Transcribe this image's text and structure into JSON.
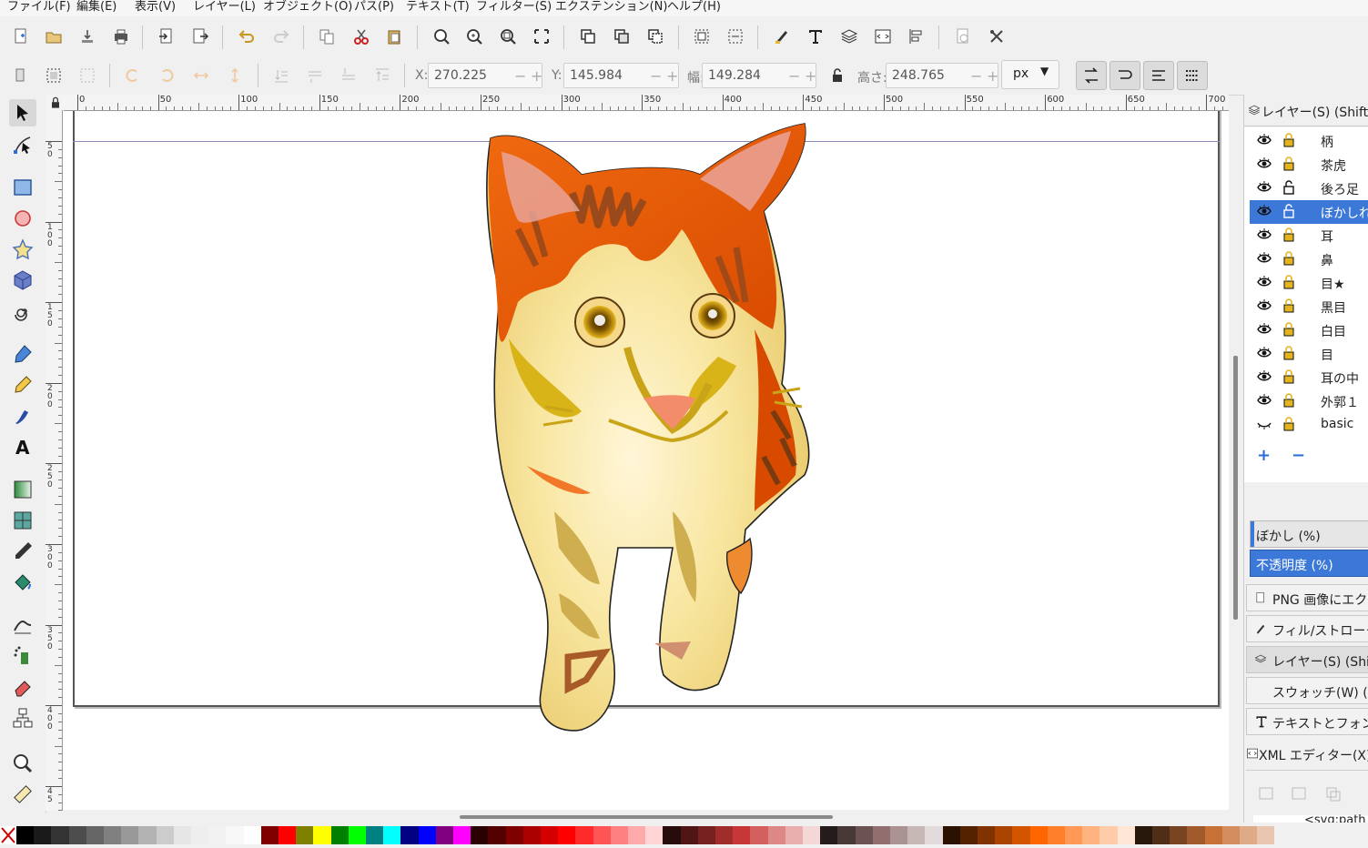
{
  "menu": [
    "ファイル(F)",
    "編集(E)",
    "表示(V)",
    "レイヤー(L)",
    "オブジェクト(O)",
    "パス(P)",
    "テキスト(T)",
    "フィルター(S)",
    "エクステンション(N)",
    "ヘルプ(H)"
  ],
  "controls": {
    "x_label": "X:",
    "x_value": "270.225",
    "y_label": "Y:",
    "y_value": "145.984",
    "w_label": "幅:",
    "w_value": "149.284",
    "h_label": "高さ:",
    "h_value": "248.765",
    "unit": "px"
  },
  "ruler": {
    "h_ticks": [
      "0",
      "50",
      "100",
      "150",
      "200",
      "250",
      "300",
      "350",
      "400",
      "450",
      "500",
      "550",
      "600",
      "650",
      "700"
    ],
    "v_ticks": [
      "5\n0",
      "1\n0\n0",
      "1\n5\n0",
      "2\n0\n0",
      "2\n5\n0",
      "3\n0\n0",
      "3\n5\n0",
      "4\n0\n0",
      "4\n5"
    ]
  },
  "layers_panel": {
    "title": "レイヤー(S) (Shift+C",
    "layers": [
      {
        "name": "柄",
        "visible": true,
        "locked": true
      },
      {
        "name": "茶虎",
        "visible": true,
        "locked": true
      },
      {
        "name": "後ろ足",
        "visible": true,
        "locked": false
      },
      {
        "name": "ぼかしれ",
        "visible": true,
        "locked": false,
        "selected": true
      },
      {
        "name": "耳",
        "visible": true,
        "locked": true
      },
      {
        "name": "鼻",
        "visible": true,
        "locked": true
      },
      {
        "name": "目★",
        "visible": true,
        "locked": true
      },
      {
        "name": "黒目",
        "visible": true,
        "locked": true
      },
      {
        "name": "白目",
        "visible": true,
        "locked": true
      },
      {
        "name": "目",
        "visible": true,
        "locked": true
      },
      {
        "name": "耳の中",
        "visible": true,
        "locked": true
      },
      {
        "name": "外郭１",
        "visible": true,
        "locked": true
      },
      {
        "name": "basic",
        "visible": false,
        "locked": true
      }
    ],
    "add_label": "+",
    "remove_label": "−",
    "blur_label": "ぼかし (%)",
    "opacity_label": "不透明度 (%)"
  },
  "docks": [
    {
      "label": "PNG 画像にエクス"
    },
    {
      "label": "フィル/ストローク(F)"
    },
    {
      "label": "レイヤー(S) (Shift+"
    },
    {
      "label": "スウォッチ(W) (Shi"
    },
    {
      "label": "テキストとフォント(T"
    },
    {
      "label": "XML エディター(X) (S"
    }
  ],
  "xml_node": "<svg:path i",
  "palette": [
    "#000000",
    "#1a1a1a",
    "#333333",
    "#4d4d4d",
    "#666666",
    "#808080",
    "#999999",
    "#b3b3b3",
    "#cccccc",
    "#e6e6e6",
    "#eeeeee",
    "#f2f2f2",
    "#f8f8f8",
    "#ffffff",
    "#800000",
    "#ff0000",
    "#808000",
    "#ffff00",
    "#008000",
    "#00ff00",
    "#008080",
    "#00ffff",
    "#000080",
    "#0000ff",
    "#800080",
    "#ff00ff",
    "#2b0000",
    "#550000",
    "#800000",
    "#aa0000",
    "#d40000",
    "#ff0000",
    "#ff2a2a",
    "#ff5555",
    "#ff8080",
    "#ffaaaa",
    "#ffd5d5",
    "#280b0b",
    "#501616",
    "#782121",
    "#a02c2c",
    "#c83737",
    "#d35f5f",
    "#de8787",
    "#e9afaf",
    "#f4d7d7",
    "#241c1c",
    "#483737",
    "#6c5353",
    "#916f6f",
    "#ac9393",
    "#c8b7b7",
    "#e3dbdb",
    "#2b1100",
    "#552200",
    "#803300",
    "#aa4400",
    "#d45500",
    "#ff6600",
    "#ff7f2a",
    "#ff9955",
    "#ffb380",
    "#ffccaa",
    "#ffe6d5",
    "#28170b",
    "#502d16",
    "#784421",
    "#a05a2c",
    "#c87137",
    "#d38d5f",
    "#deaa87",
    "#e9c6af"
  ]
}
